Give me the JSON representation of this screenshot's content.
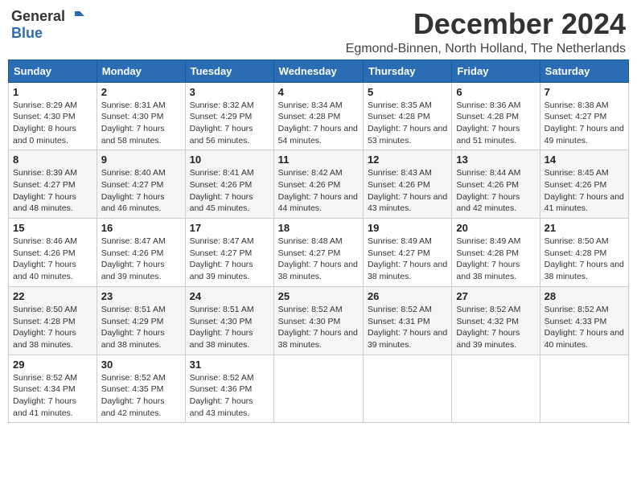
{
  "logo": {
    "general": "General",
    "blue": "Blue"
  },
  "header": {
    "title": "December 2024",
    "subtitle": "Egmond-Binnen, North Holland, The Netherlands"
  },
  "days_of_week": [
    "Sunday",
    "Monday",
    "Tuesday",
    "Wednesday",
    "Thursday",
    "Friday",
    "Saturday"
  ],
  "weeks": [
    [
      {
        "day": "1",
        "sunrise": "8:29 AM",
        "sunset": "4:30 PM",
        "daylight": "8 hours and 0 minutes."
      },
      {
        "day": "2",
        "sunrise": "8:31 AM",
        "sunset": "4:30 PM",
        "daylight": "7 hours and 58 minutes."
      },
      {
        "day": "3",
        "sunrise": "8:32 AM",
        "sunset": "4:29 PM",
        "daylight": "7 hours and 56 minutes."
      },
      {
        "day": "4",
        "sunrise": "8:34 AM",
        "sunset": "4:28 PM",
        "daylight": "7 hours and 54 minutes."
      },
      {
        "day": "5",
        "sunrise": "8:35 AM",
        "sunset": "4:28 PM",
        "daylight": "7 hours and 53 minutes."
      },
      {
        "day": "6",
        "sunrise": "8:36 AM",
        "sunset": "4:28 PM",
        "daylight": "7 hours and 51 minutes."
      },
      {
        "day": "7",
        "sunrise": "8:38 AM",
        "sunset": "4:27 PM",
        "daylight": "7 hours and 49 minutes."
      }
    ],
    [
      {
        "day": "8",
        "sunrise": "8:39 AM",
        "sunset": "4:27 PM",
        "daylight": "7 hours and 48 minutes."
      },
      {
        "day": "9",
        "sunrise": "8:40 AM",
        "sunset": "4:27 PM",
        "daylight": "7 hours and 46 minutes."
      },
      {
        "day": "10",
        "sunrise": "8:41 AM",
        "sunset": "4:26 PM",
        "daylight": "7 hours and 45 minutes."
      },
      {
        "day": "11",
        "sunrise": "8:42 AM",
        "sunset": "4:26 PM",
        "daylight": "7 hours and 44 minutes."
      },
      {
        "day": "12",
        "sunrise": "8:43 AM",
        "sunset": "4:26 PM",
        "daylight": "7 hours and 43 minutes."
      },
      {
        "day": "13",
        "sunrise": "8:44 AM",
        "sunset": "4:26 PM",
        "daylight": "7 hours and 42 minutes."
      },
      {
        "day": "14",
        "sunrise": "8:45 AM",
        "sunset": "4:26 PM",
        "daylight": "7 hours and 41 minutes."
      }
    ],
    [
      {
        "day": "15",
        "sunrise": "8:46 AM",
        "sunset": "4:26 PM",
        "daylight": "7 hours and 40 minutes."
      },
      {
        "day": "16",
        "sunrise": "8:47 AM",
        "sunset": "4:26 PM",
        "daylight": "7 hours and 39 minutes."
      },
      {
        "day": "17",
        "sunrise": "8:47 AM",
        "sunset": "4:27 PM",
        "daylight": "7 hours and 39 minutes."
      },
      {
        "day": "18",
        "sunrise": "8:48 AM",
        "sunset": "4:27 PM",
        "daylight": "7 hours and 38 minutes."
      },
      {
        "day": "19",
        "sunrise": "8:49 AM",
        "sunset": "4:27 PM",
        "daylight": "7 hours and 38 minutes."
      },
      {
        "day": "20",
        "sunrise": "8:49 AM",
        "sunset": "4:28 PM",
        "daylight": "7 hours and 38 minutes."
      },
      {
        "day": "21",
        "sunrise": "8:50 AM",
        "sunset": "4:28 PM",
        "daylight": "7 hours and 38 minutes."
      }
    ],
    [
      {
        "day": "22",
        "sunrise": "8:50 AM",
        "sunset": "4:28 PM",
        "daylight": "7 hours and 38 minutes."
      },
      {
        "day": "23",
        "sunrise": "8:51 AM",
        "sunset": "4:29 PM",
        "daylight": "7 hours and 38 minutes."
      },
      {
        "day": "24",
        "sunrise": "8:51 AM",
        "sunset": "4:30 PM",
        "daylight": "7 hours and 38 minutes."
      },
      {
        "day": "25",
        "sunrise": "8:52 AM",
        "sunset": "4:30 PM",
        "daylight": "7 hours and 38 minutes."
      },
      {
        "day": "26",
        "sunrise": "8:52 AM",
        "sunset": "4:31 PM",
        "daylight": "7 hours and 39 minutes."
      },
      {
        "day": "27",
        "sunrise": "8:52 AM",
        "sunset": "4:32 PM",
        "daylight": "7 hours and 39 minutes."
      },
      {
        "day": "28",
        "sunrise": "8:52 AM",
        "sunset": "4:33 PM",
        "daylight": "7 hours and 40 minutes."
      }
    ],
    [
      {
        "day": "29",
        "sunrise": "8:52 AM",
        "sunset": "4:34 PM",
        "daylight": "7 hours and 41 minutes."
      },
      {
        "day": "30",
        "sunrise": "8:52 AM",
        "sunset": "4:35 PM",
        "daylight": "7 hours and 42 minutes."
      },
      {
        "day": "31",
        "sunrise": "8:52 AM",
        "sunset": "4:36 PM",
        "daylight": "7 hours and 43 minutes."
      },
      null,
      null,
      null,
      null
    ]
  ]
}
